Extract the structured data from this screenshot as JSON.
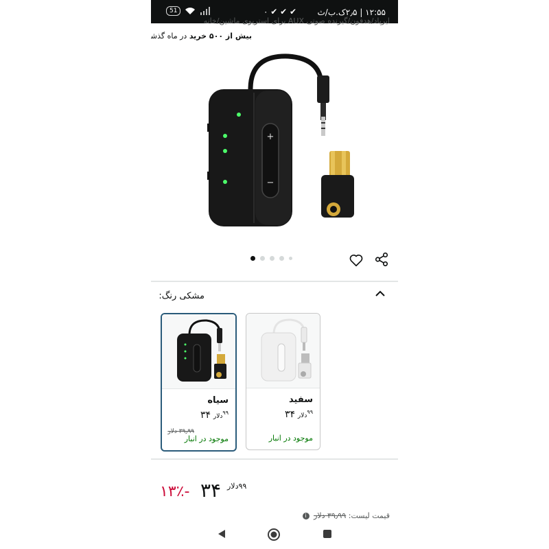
{
  "status_bar": {
    "time": "۱۲:۵۵ | ۲٫۵ک.ب/ث",
    "battery": "51",
    "notification_zero": "۰"
  },
  "product": {
    "title_truncated": "ایرپاد/هدفون/گیرنده صوتی AUX برای استریوی ماشین/خانه",
    "bought_bold": "بیش از ۵۰۰ خرید",
    "bought_suffix": "در ماه گذشته",
    "image_icon": "bluetooth-adapter-black-image",
    "carousel_count": 5,
    "carousel_active": 0
  },
  "color_section": {
    "label_prefix": "رنگ:",
    "selected_color": "مشکی",
    "options": [
      {
        "name": "سیاه",
        "price": "۳۴",
        "price_cents": "۹۹",
        "currency": "دلار",
        "old_price": "۳۹٫۹۹ دلار",
        "stock": "موجود در انبار",
        "selected": true,
        "image_icon": "black-adapter-thumb"
      },
      {
        "name": "سفید",
        "price": "۳۴",
        "price_cents": "۹۹",
        "currency": "دلار",
        "old_price": "",
        "stock": "موجود در انبار",
        "selected": false,
        "image_icon": "white-adapter-thumb"
      }
    ]
  },
  "pricing": {
    "discount": "-۱۳٪",
    "price": "۳۴",
    "price_cents": "۹۹",
    "currency": "دلار",
    "list_price_label": "قیمت لیست:",
    "list_price_value": "۳۹٫۹۹ دلار"
  },
  "colors": {
    "discount_red": "#cc0c39",
    "stock_green": "#007600",
    "selected_border": "#2a5b7a"
  }
}
